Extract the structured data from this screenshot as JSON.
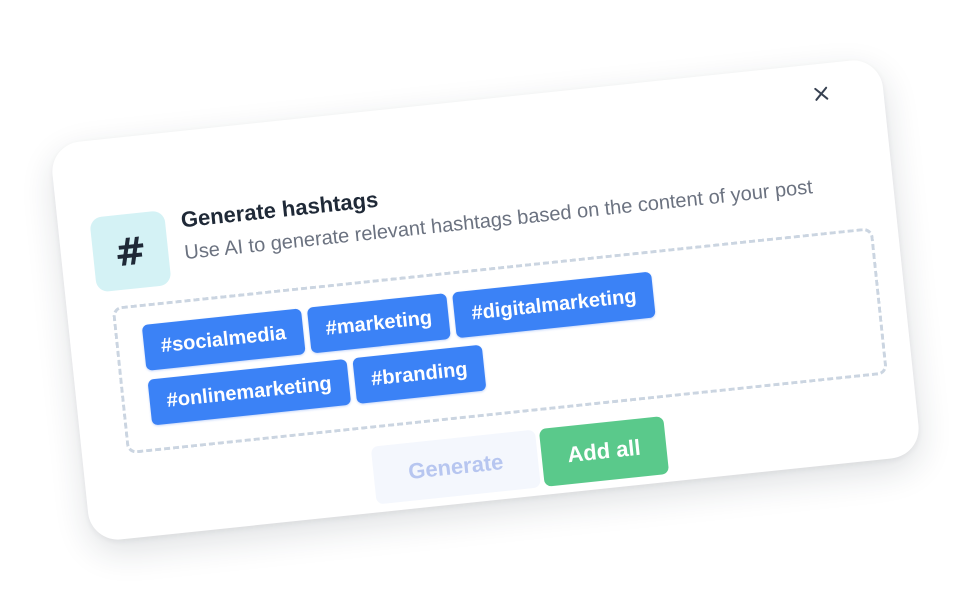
{
  "dialog": {
    "icon": "hash-icon",
    "icon_glyph": "#",
    "title": "Generate hashtags",
    "subtitle": "Use AI to generate relevant hashtags based on the content of your post",
    "close_icon": "close-icon"
  },
  "hashtags": [
    "#socialmedia",
    "#marketing",
    "#digitalmarketing",
    "#onlinemarketing",
    "#branding"
  ],
  "actions": {
    "generate_label": "Generate",
    "generate_state": "disabled",
    "add_all_label": "Add all"
  },
  "colors": {
    "tag": "#3b82f6",
    "add_all": "#5ac98b",
    "icon_bg": "#d4f2f5",
    "generate_disabled_text": "#b7c6f0"
  }
}
